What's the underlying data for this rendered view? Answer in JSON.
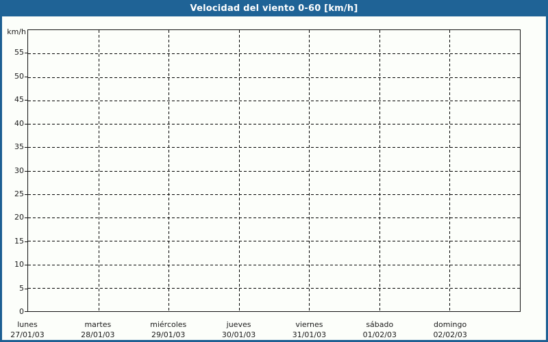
{
  "title_bar": {
    "title": "Velocidad del viento 0-60 [km/h]"
  },
  "colors": {
    "title_bar_bg": "#1f6396",
    "title_text": "#ffffff",
    "page_border": "#1d5f92",
    "background": "#fcfefa",
    "plot_border": "#111111",
    "grid_line": "#000000",
    "label_text": "#1a1a1a"
  },
  "chart_data": {
    "type": "line",
    "title": "Velocidad del viento 0-60 [km/h]",
    "xlabel": "",
    "ylabel": "km/h",
    "ylim": [
      0,
      60
    ],
    "y_ticks": [
      0,
      5,
      10,
      15,
      20,
      25,
      30,
      35,
      40,
      45,
      50,
      55
    ],
    "x_categories": [
      {
        "day": "lunes",
        "date": "27/01/03"
      },
      {
        "day": "martes",
        "date": "28/01/03"
      },
      {
        "day": "miércoles",
        "date": "29/01/03"
      },
      {
        "day": "jueves",
        "date": "30/01/03"
      },
      {
        "day": "viernes",
        "date": "31/01/03"
      },
      {
        "day": "sábado",
        "date": "01/02/03"
      },
      {
        "day": "domingo",
        "date": "02/02/03"
      }
    ],
    "series": [],
    "grid": "dashed",
    "legend": "none"
  }
}
